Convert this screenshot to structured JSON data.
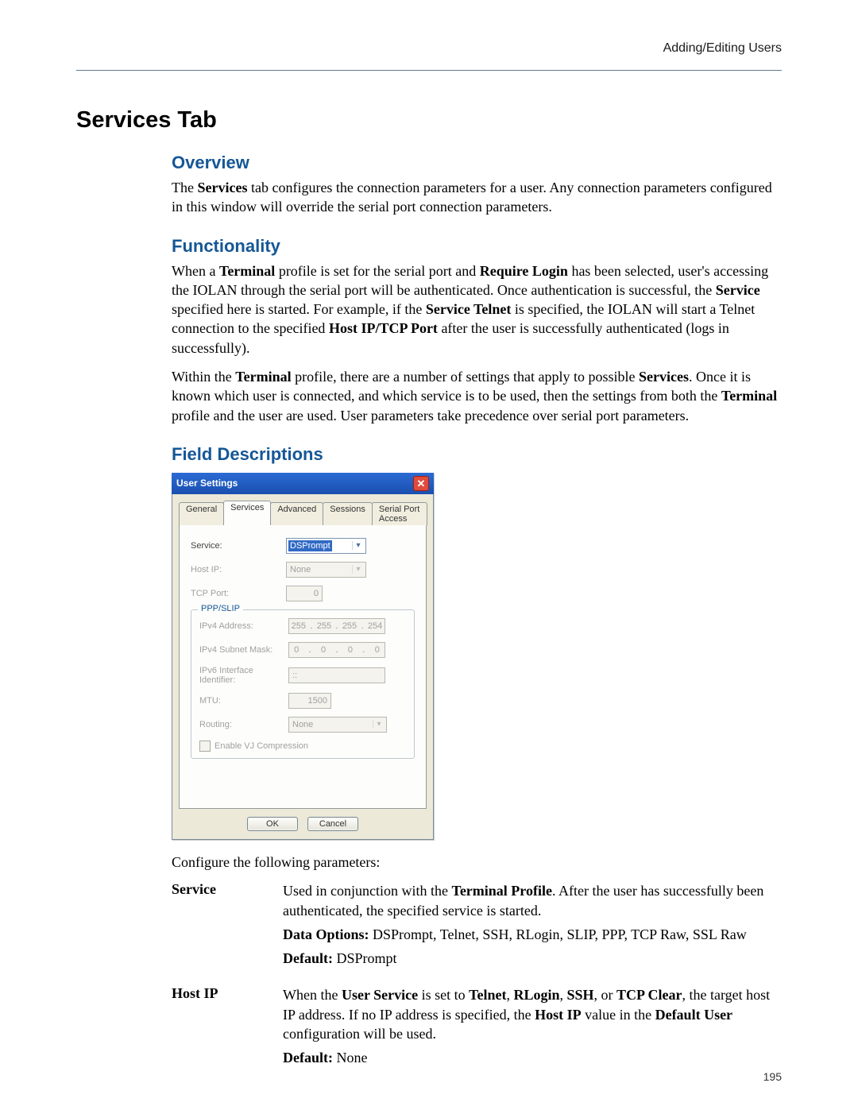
{
  "header": {
    "breadcrumb": "Adding/Editing Users"
  },
  "title": "Services Tab",
  "overview": {
    "heading": "Overview",
    "text_pre": "The ",
    "text_bold1": "Services",
    "text_post": " tab configures the connection parameters for a user. Any connection parameters configured in this window will override the serial port connection parameters."
  },
  "functionality": {
    "heading": "Functionality",
    "p1a": "When a ",
    "p1b": "Terminal",
    "p1c": " profile is set for the serial port and ",
    "p1d": "Require Login",
    "p1e": " has been selected, user's accessing the IOLAN through the serial port will be authenticated. Once authentication is successful, the ",
    "p1f": "Service",
    "p1g": " specified here is started. For example, if the ",
    "p1h": "Service Telnet",
    "p1i": " is specified, the IOLAN will start a Telnet connection to the specified ",
    "p1j": "Host IP/TCP Port",
    "p1k": " after the user is successfully authenticated (logs in successfully).",
    "p2a": "Within the ",
    "p2b": "Terminal",
    "p2c": " profile, there are a number of settings that apply to possible ",
    "p2d": "Services",
    "p2e": ". Once it is known which user is connected, and which service is to be used, then the settings from both the ",
    "p2f": "Terminal",
    "p2g": " profile and the user are used. User parameters take precedence over serial port parameters."
  },
  "field_desc_heading": "Field Descriptions",
  "dialog": {
    "title": "User Settings",
    "close": "✕",
    "tabs": [
      "General",
      "Services",
      "Advanced",
      "Sessions",
      "Serial Port Access"
    ],
    "active_tab_index": 1,
    "fields": {
      "service_label": "Service:",
      "service_value": "DSPrompt",
      "hostip_label": "Host IP:",
      "hostip_value": "None",
      "tcpport_label": "TCP Port:",
      "tcpport_value": "0"
    },
    "pppslip": {
      "legend": "PPP/SLIP",
      "ipv4addr_label": "IPv4 Address:",
      "ipv4addr_octets": [
        "255",
        "255",
        "255",
        "254"
      ],
      "ipv4mask_label": "IPv4 Subnet Mask:",
      "ipv4mask_octets": [
        "0",
        "0",
        "0",
        "0"
      ],
      "ipv6id_label": "IPv6 Interface Identifier:",
      "ipv6id_value": "::",
      "mtu_label": "MTU:",
      "mtu_value": "1500",
      "routing_label": "Routing:",
      "routing_value": "None",
      "vj_label": "Enable VJ Compression"
    },
    "buttons": {
      "ok": "OK",
      "cancel": "Cancel"
    }
  },
  "configure_sentence": "Configure the following parameters:",
  "fields_table": {
    "service": {
      "label": "Service",
      "d1a": "Used in conjunction with the ",
      "d1b": "Terminal Profile",
      "d1c": ". After the user has successfully been authenticated, the specified service is started.",
      "d2a": "Data Options:",
      "d2b": " DSPrompt, Telnet, SSH, RLogin, SLIP, PPP, TCP Raw, SSL Raw",
      "d3a": "Default:",
      "d3b": " DSPrompt"
    },
    "hostip": {
      "label": "Host IP",
      "d1a": "When the ",
      "d1b": "User Service",
      "d1c": " is set to ",
      "d1d": "Telnet",
      "d1e": ", ",
      "d1f": "RLogin",
      "d1g": ", ",
      "d1h": "SSH",
      "d1i": ", or ",
      "d1j": "TCP Clear",
      "d1k": ", the target host IP address. If no IP address is specified, the ",
      "d1l": "Host IP",
      "d1m": " value in the ",
      "d1n": "Default User",
      "d1o": " configuration will be used.",
      "d2a": "Default:",
      "d2b": " None"
    }
  },
  "page_number": "195"
}
